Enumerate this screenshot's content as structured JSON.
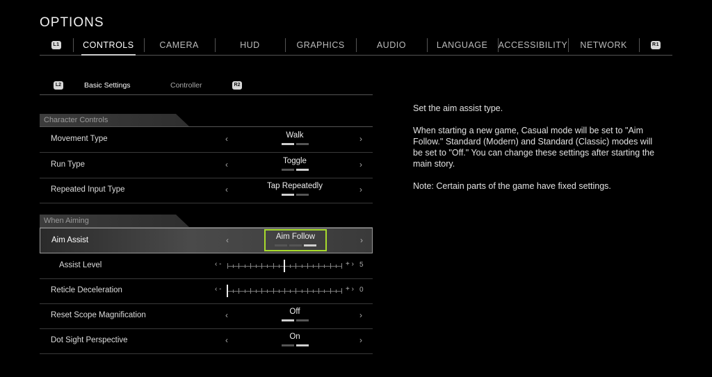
{
  "header": {
    "title": "OPTIONS"
  },
  "tabs": {
    "left_badge": "L1",
    "right_badge": "R1",
    "items": [
      "CONTROLS",
      "CAMERA",
      "HUD",
      "GRAPHICS",
      "AUDIO",
      "LANGUAGE",
      "ACCESSIBILITY",
      "NETWORK"
    ],
    "active": "CONTROLS"
  },
  "subtabs": {
    "left_badge": "L2",
    "right_badge": "R2",
    "items": [
      "Basic Settings",
      "Controller"
    ],
    "active": "Basic Settings"
  },
  "sections": {
    "character": "Character Controls",
    "aiming": "When Aiming"
  },
  "settings": {
    "movement_type": {
      "label": "Movement Type",
      "value": "Walk",
      "option_count": 2,
      "selected_index": 0
    },
    "run_type": {
      "label": "Run Type",
      "value": "Toggle",
      "option_count": 2,
      "selected_index": 1
    },
    "repeated_input": {
      "label": "Repeated Input Type",
      "value": "Tap Repeatedly",
      "option_count": 2,
      "selected_index": 0
    },
    "aim_assist": {
      "label": "Aim Assist",
      "value": "Aim Follow",
      "option_count": 3,
      "selected_index": 2
    },
    "assist_level": {
      "label": "Assist Level",
      "value": "5",
      "min": 0,
      "max": 10
    },
    "reticle_decel": {
      "label": "Reticle Deceleration",
      "value": "0",
      "min": 0,
      "max": 10
    },
    "reset_scope": {
      "label": "Reset Scope Magnification",
      "value": "Off",
      "option_count": 2,
      "selected_index": 0
    },
    "dot_sight": {
      "label": "Dot Sight Perspective",
      "value": "On",
      "option_count": 2,
      "selected_index": 1
    }
  },
  "arrows": {
    "left": "‹",
    "right": "›",
    "minus": "‹ -",
    "plus": "+ ›"
  },
  "description": {
    "line1": "Set the aim assist type.",
    "line2": "When starting a new game, Casual mode will be set to \"Aim Follow.\" Standard (Modern) and Standard (Classic) modes will be set to \"Off.\" You can change these settings after starting the main story.",
    "line3": "Note: Certain parts of the game have fixed settings."
  },
  "colors": {
    "highlight": "#a8dc2c",
    "background": "#000000"
  }
}
